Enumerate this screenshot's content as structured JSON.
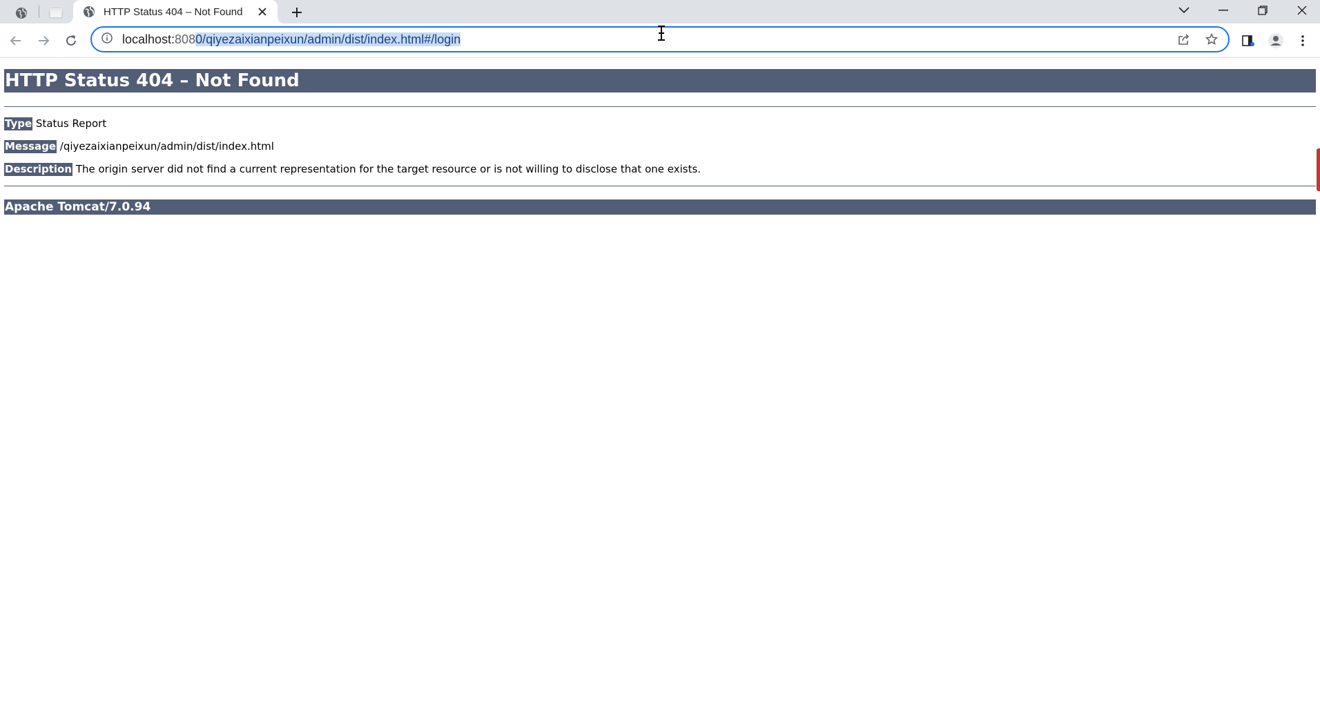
{
  "browser": {
    "tabs": [
      {
        "type": "pinned",
        "icon": "globe-icon"
      },
      {
        "type": "pinned",
        "icon": "blank-page-icon"
      },
      {
        "type": "active",
        "icon": "globe-icon",
        "title": "HTTP Status 404 – Not Found"
      }
    ],
    "omnibox": {
      "host": "localhost:",
      "port_unselected": "808",
      "selected_text": "0/qiyezaixianpeixun/admin/dist/index.html#/login"
    },
    "accent_color": "#1a73e8"
  },
  "page": {
    "title": "HTTP Status 404 – Not Found",
    "rows": [
      {
        "label": "Type",
        "value": "Status Report"
      },
      {
        "label": "Message",
        "value": "/qiyezaixianpeixun/admin/dist/index.html"
      },
      {
        "label": "Description",
        "value": "The origin server did not find a current representation for the target resource or is not willing to disclose that one exists."
      }
    ],
    "footer": "Apache Tomcat/7.0.94",
    "header_color": "#525d76"
  }
}
